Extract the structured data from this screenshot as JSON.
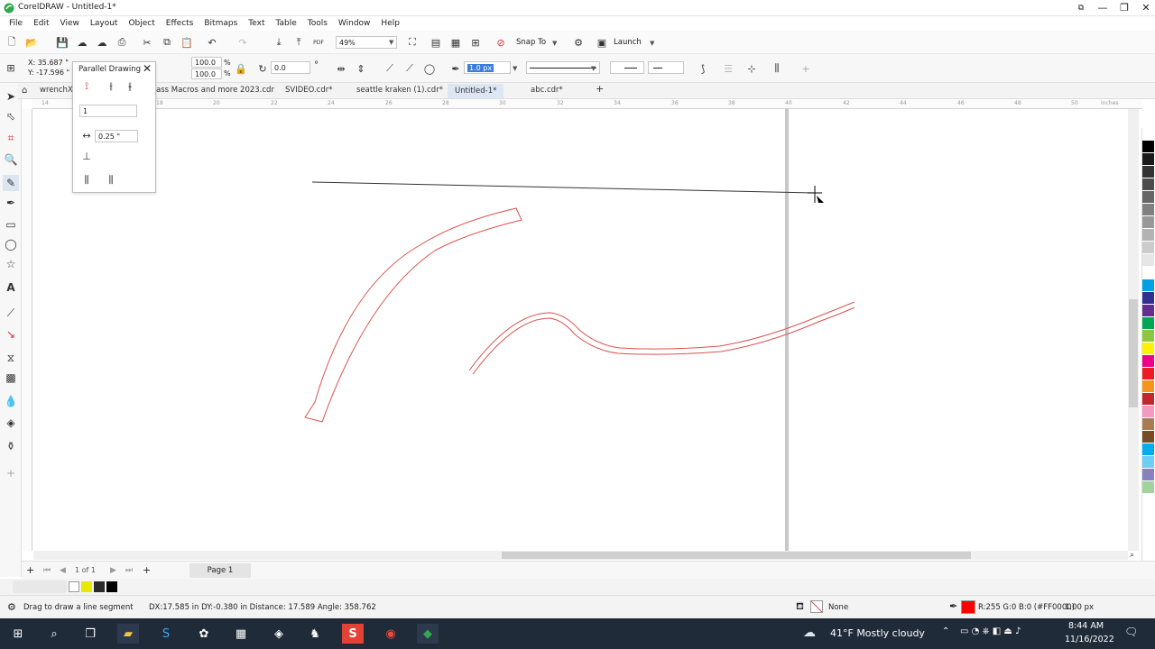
{
  "window": {
    "title": "CorelDRAW - Untitled-1*",
    "minimize": "—",
    "maximize": "❐",
    "close": "✕"
  },
  "menu": [
    "File",
    "Edit",
    "View",
    "Layout",
    "Object",
    "Effects",
    "Bitmaps",
    "Text",
    "Table",
    "Tools",
    "Window",
    "Help"
  ],
  "toolbar": {
    "zoom_value": "49%",
    "snap_label": "Snap To",
    "launch_label": "Launch",
    "pdf_label": "PDF"
  },
  "propbar": {
    "x": "X: 35.687 \"",
    "y": "Y: -17.596 \"",
    "w_pct": "100.0",
    "h_pct": "100.0",
    "pct_sign": "%",
    "rotation": "0.0",
    "degree_sign": "°",
    "outline_width": "1.0 px"
  },
  "docker": {
    "title": "Parallel Drawing",
    "count_value": "1",
    "distance_value": "0.25 \""
  },
  "tabs": [
    {
      "label": "wrenchX7"
    },
    {
      "label": "ass Macros and more 2023.cdr"
    },
    {
      "label": "SVIDEO.cdr*"
    },
    {
      "label": "seattle kraken (1).cdr*"
    },
    {
      "label": "Untitled-1*",
      "active": true
    },
    {
      "label": "abc.cdr*"
    }
  ],
  "ruler": {
    "labels": [
      "14",
      "16",
      "18",
      "20",
      "22",
      "24",
      "26",
      "28",
      "30",
      "32",
      "34",
      "36",
      "38",
      "40",
      "42",
      "44",
      "46",
      "48",
      "50"
    ],
    "unit": "inches"
  },
  "pagenav": {
    "page_count": "1  of  1",
    "page_label": "Page 1"
  },
  "status": {
    "hint": "Drag to draw a line segment",
    "measure": "DX:17.585 in DY:-0.380 in Distance: 17.589 Angle: 358.762",
    "fill_label": "None",
    "outline_color": "R:255 G:0 B:0 (#FF0000)",
    "outline_width": "1.00 px"
  },
  "taskbar": {
    "weather": "41°F  Mostly cloudy",
    "time": "8:44 AM",
    "date": "11/16/2022"
  },
  "colors": {
    "curve_stroke": "#d9534f",
    "palette": [
      "#ffffff",
      "#000000",
      "#1a1a1a",
      "#333333",
      "#4d4d4d",
      "#666666",
      "#808080",
      "#999999",
      "#b3b3b3",
      "#cccccc",
      "#e6e6e6",
      "#ffffff",
      "#00a0e3",
      "#2e3192",
      "#662d91",
      "#00a651",
      "#8dc63f",
      "#fff200",
      "#ec008c",
      "#ed1c24",
      "#f7941d",
      "#c1272d",
      "#f49ac1",
      "#a67c52",
      "#754c24",
      "#00aeef",
      "#6dcff6",
      "#8781bd",
      "#a3d39c"
    ]
  }
}
